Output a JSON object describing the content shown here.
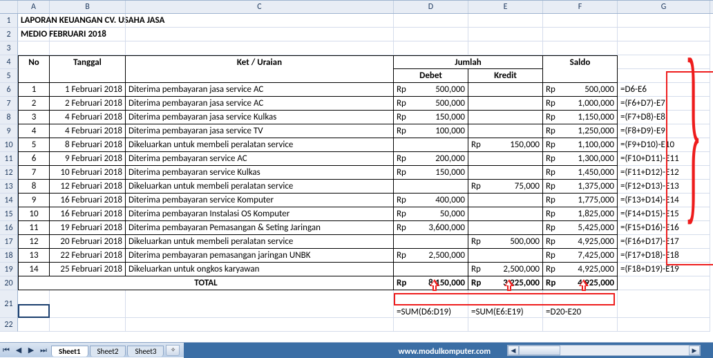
{
  "columns": [
    "",
    "A",
    "B",
    "C",
    "D",
    "E",
    "F",
    "G"
  ],
  "title": "LAPORAN KEUANGAN CV. USAHA JASA",
  "subtitle": "MEDIO FEBRUARI 2018",
  "headers": {
    "no": "No",
    "tanggal": "Tanggal",
    "ket": "Ket / Uraian",
    "jumlah": "Jumlah",
    "debet": "Debet",
    "kredit": "Kredit",
    "saldo": "Saldo"
  },
  "currency": "Rp",
  "rows": [
    {
      "no": "1",
      "tgl": "1 Februari 2018",
      "ket": "Diterima pembayaran jasa service AC",
      "debet": "500,000",
      "kredit": "",
      "saldo": "500,000",
      "f": "=D6-E6"
    },
    {
      "no": "2",
      "tgl": "2 Februari 2018",
      "ket": "Diterima pembayaran jasa service AC",
      "debet": "500,000",
      "kredit": "",
      "saldo": "1,000,000",
      "f": "=(F6+D7)-E7"
    },
    {
      "no": "3",
      "tgl": "4 Februari 2018",
      "ket": "Diterima pembayaran jasa service Kulkas",
      "debet": "150,000",
      "kredit": "",
      "saldo": "1,150,000",
      "f": "=(F7+D8)-E8"
    },
    {
      "no": "4",
      "tgl": "4 Februari 2018",
      "ket": "Diterima pembayaran jasa service TV",
      "debet": "100,000",
      "kredit": "",
      "saldo": "1,250,000",
      "f": "=(F8+D9)-E9"
    },
    {
      "no": "5",
      "tgl": "8 Februari 2018",
      "ket": "Dikeluarkan untuk membeli peralatan service",
      "debet": "",
      "kredit": "150,000",
      "saldo": "1,100,000",
      "f": "=(F9+D10)-E10"
    },
    {
      "no": "6",
      "tgl": "9 Februari 2018",
      "ket": "Diterima pembayaran service AC",
      "debet": "200,000",
      "kredit": "",
      "saldo": "1,300,000",
      "f": "=(F10+D11)-E11"
    },
    {
      "no": "7",
      "tgl": "10 Februari 2018",
      "ket": "Diterima pembayaran service Kulkas",
      "debet": "150,000",
      "kredit": "",
      "saldo": "1,450,000",
      "f": "=(F11+D12)-E12"
    },
    {
      "no": "8",
      "tgl": "12 Februari 2018",
      "ket": "Dikeluarkan untuk membeli peralatan service",
      "debet": "",
      "kredit": "75,000",
      "saldo": "1,375,000",
      "f": "=(F12+D13)-E13"
    },
    {
      "no": "9",
      "tgl": "16 Februari 2018",
      "ket": "Diterima pembayaran service Komputer",
      "debet": "400,000",
      "kredit": "",
      "saldo": "1,775,000",
      "f": "=(F13+D14)-E14"
    },
    {
      "no": "10",
      "tgl": "16 Februari 2018",
      "ket": "Diterima pembayaran Instalasi OS Komputer",
      "debet": "50,000",
      "kredit": "",
      "saldo": "1,825,000",
      "f": "=(F14+D15)-E15"
    },
    {
      "no": "11",
      "tgl": "19 Februari 2018",
      "ket": "Diterima pembayaran Pemasangan & Seting Jaringan",
      "debet": "3,600,000",
      "kredit": "",
      "saldo": "5,425,000",
      "f": "=(F15+D16)-E16"
    },
    {
      "no": "12",
      "tgl": "20 Februari 2018",
      "ket": "Dikeluarkan untuk membeli peralatan service",
      "debet": "",
      "kredit": "500,000",
      "saldo": "4,925,000",
      "f": "=(F16+D17)-E17"
    },
    {
      "no": "13",
      "tgl": "22 Februari 2018",
      "ket": "Diterima pembayaran pemasangan jaringan UNBK",
      "debet": "2,500,000",
      "kredit": "",
      "saldo": "7,425,000",
      "f": "=(F17+D18)-E18"
    },
    {
      "no": "14",
      "tgl": "25 Februari 2018",
      "ket": "Dikeluarkan untuk ongkos karyawan",
      "debet": "",
      "kredit": "2,500,000",
      "saldo": "4,925,000",
      "f": "=(F18+D19)-E19"
    }
  ],
  "total": {
    "label": "TOTAL",
    "debet": "8,150,000",
    "kredit": "3,225,000",
    "saldo": "4,925,000"
  },
  "formulas_bottom": {
    "d": "=SUM(D6:D19)",
    "e": "=SUM(E6:E19)",
    "f": "=D20-E20"
  },
  "sheets": [
    "Sheet1",
    "Sheet2",
    "Sheet3"
  ],
  "watermark": "www.modulkomputer.com",
  "chart_data": {
    "type": "table",
    "title": "LAPORAN KEUANGAN CV. USAHA JASA — MEDIO FEBRUARI 2018",
    "columns": [
      "No",
      "Tanggal",
      "Ket / Uraian",
      "Debet",
      "Kredit",
      "Saldo"
    ],
    "rows": [
      [
        1,
        "1 Februari 2018",
        "Diterima pembayaran jasa service AC",
        500000,
        null,
        500000
      ],
      [
        2,
        "2 Februari 2018",
        "Diterima pembayaran jasa service AC",
        500000,
        null,
        1000000
      ],
      [
        3,
        "4 Februari 2018",
        "Diterima pembayaran jasa service Kulkas",
        150000,
        null,
        1150000
      ],
      [
        4,
        "4 Februari 2018",
        "Diterima pembayaran jasa service TV",
        100000,
        null,
        1250000
      ],
      [
        5,
        "8 Februari 2018",
        "Dikeluarkan untuk membeli peralatan service",
        null,
        150000,
        1100000
      ],
      [
        6,
        "9 Februari 2018",
        "Diterima pembayaran service AC",
        200000,
        null,
        1300000
      ],
      [
        7,
        "10 Februari 2018",
        "Diterima pembayaran service Kulkas",
        150000,
        null,
        1450000
      ],
      [
        8,
        "12 Februari 2018",
        "Dikeluarkan untuk membeli peralatan service",
        null,
        75000,
        1375000
      ],
      [
        9,
        "16 Februari 2018",
        "Diterima pembayaran service Komputer",
        400000,
        null,
        1775000
      ],
      [
        10,
        "16 Februari 2018",
        "Diterima pembayaran Instalasi OS Komputer",
        50000,
        null,
        1825000
      ],
      [
        11,
        "19 Februari 2018",
        "Diterima pembayaran Pemasangan & Seting Jaringan",
        3600000,
        null,
        5425000
      ],
      [
        12,
        "20 Februari 2018",
        "Dikeluarkan untuk membeli peralatan service",
        null,
        500000,
        4925000
      ],
      [
        13,
        "22 Februari 2018",
        "Diterima pembayaran pemasangan jaringan UNBK",
        2500000,
        null,
        7425000
      ],
      [
        14,
        "25 Februari 2018",
        "Dikeluarkan untuk ongkos karyawan",
        null,
        2500000,
        4925000
      ]
    ],
    "totals": {
      "Debet": 8150000,
      "Kredit": 3225000,
      "Saldo": 4925000
    }
  }
}
